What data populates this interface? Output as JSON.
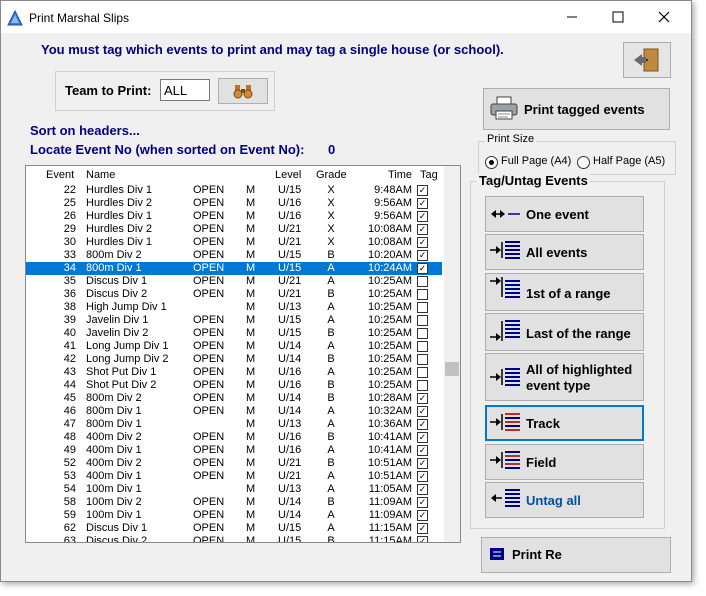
{
  "window": {
    "title": "Print Marshal Slips"
  },
  "instruction": "You must tag which events to print and may tag a single house (or school).",
  "team": {
    "label": "Team to Print:",
    "value": "ALL"
  },
  "sort_text": "Sort on headers...",
  "locate": {
    "label": "Locate Event No (when sorted on Event No):",
    "value": "0"
  },
  "grid": {
    "headers": {
      "event": "Event",
      "name": "Name",
      "level": "Level",
      "grade": "Grade",
      "time": "Time",
      "tag": "Tag"
    },
    "rows": [
      {
        "event": "22",
        "name": "Hurdles Div 1",
        "status": "OPEN",
        "gender": "M",
        "level": "U/15",
        "grade": "X",
        "time": "9:48AM",
        "tag": true
      },
      {
        "event": "25",
        "name": "Hurdles Div 2",
        "status": "OPEN",
        "gender": "M",
        "level": "U/16",
        "grade": "X",
        "time": "9:56AM",
        "tag": true
      },
      {
        "event": "26",
        "name": "Hurdles Div 1",
        "status": "OPEN",
        "gender": "M",
        "level": "U/16",
        "grade": "X",
        "time": "9:56AM",
        "tag": true
      },
      {
        "event": "29",
        "name": "Hurdles Div 2",
        "status": "OPEN",
        "gender": "M",
        "level": "U/21",
        "grade": "X",
        "time": "10:08AM",
        "tag": true
      },
      {
        "event": "30",
        "name": "Hurdles Div 1",
        "status": "OPEN",
        "gender": "M",
        "level": "U/21",
        "grade": "X",
        "time": "10:08AM",
        "tag": true
      },
      {
        "event": "33",
        "name": "800m Div 2",
        "status": "OPEN",
        "gender": "M",
        "level": "U/15",
        "grade": "B",
        "time": "10:20AM",
        "tag": true
      },
      {
        "event": "34",
        "name": "800m Div 1",
        "status": "OPEN",
        "gender": "M",
        "level": "U/15",
        "grade": "A",
        "time": "10:24AM",
        "tag": true,
        "selected": true
      },
      {
        "event": "35",
        "name": "Discus Div 1",
        "status": "OPEN",
        "gender": "M",
        "level": "U/21",
        "grade": "A",
        "time": "10:25AM",
        "tag": false
      },
      {
        "event": "36",
        "name": "Discus Div 2",
        "status": "OPEN",
        "gender": "M",
        "level": "U/21",
        "grade": "B",
        "time": "10:25AM",
        "tag": false
      },
      {
        "event": "38",
        "name": "High Jump Div 1",
        "status": "",
        "gender": "M",
        "level": "U/13",
        "grade": "A",
        "time": "10:25AM",
        "tag": false
      },
      {
        "event": "39",
        "name": "Javelin Div 1",
        "status": "OPEN",
        "gender": "M",
        "level": "U/15",
        "grade": "A",
        "time": "10:25AM",
        "tag": false
      },
      {
        "event": "40",
        "name": "Javelin Div 2",
        "status": "OPEN",
        "gender": "M",
        "level": "U/15",
        "grade": "B",
        "time": "10:25AM",
        "tag": false
      },
      {
        "event": "41",
        "name": "Long Jump Div 1",
        "status": "OPEN",
        "gender": "M",
        "level": "U/14",
        "grade": "A",
        "time": "10:25AM",
        "tag": false
      },
      {
        "event": "42",
        "name": "Long Jump Div 2",
        "status": "OPEN",
        "gender": "M",
        "level": "U/14",
        "grade": "B",
        "time": "10:25AM",
        "tag": false
      },
      {
        "event": "43",
        "name": "Shot Put Div 1",
        "status": "OPEN",
        "gender": "M",
        "level": "U/16",
        "grade": "A",
        "time": "10:25AM",
        "tag": false
      },
      {
        "event": "44",
        "name": "Shot Put Div 2",
        "status": "OPEN",
        "gender": "M",
        "level": "U/16",
        "grade": "B",
        "time": "10:25AM",
        "tag": false
      },
      {
        "event": "45",
        "name": "800m Div 2",
        "status": "OPEN",
        "gender": "M",
        "level": "U/14",
        "grade": "B",
        "time": "10:28AM",
        "tag": true
      },
      {
        "event": "46",
        "name": "800m Div 1",
        "status": "OPEN",
        "gender": "M",
        "level": "U/14",
        "grade": "A",
        "time": "10:32AM",
        "tag": true
      },
      {
        "event": "47",
        "name": "800m Div 1",
        "status": "",
        "gender": "M",
        "level": "U/13",
        "grade": "A",
        "time": "10:36AM",
        "tag": true
      },
      {
        "event": "48",
        "name": "400m Div 2",
        "status": "OPEN",
        "gender": "M",
        "level": "U/16",
        "grade": "B",
        "time": "10:41AM",
        "tag": true
      },
      {
        "event": "49",
        "name": "400m Div 1",
        "status": "OPEN",
        "gender": "M",
        "level": "U/16",
        "grade": "A",
        "time": "10:41AM",
        "tag": true
      },
      {
        "event": "52",
        "name": "400m Div 2",
        "status": "OPEN",
        "gender": "M",
        "level": "U/21",
        "grade": "B",
        "time": "10:51AM",
        "tag": true
      },
      {
        "event": "53",
        "name": "400m Div 1",
        "status": "OPEN",
        "gender": "M",
        "level": "U/21",
        "grade": "A",
        "time": "10:51AM",
        "tag": true
      },
      {
        "event": "54",
        "name": "100m Div 1",
        "status": "",
        "gender": "M",
        "level": "U/13",
        "grade": "A",
        "time": "11:05AM",
        "tag": true
      },
      {
        "event": "58",
        "name": "100m Div 2",
        "status": "OPEN",
        "gender": "M",
        "level": "U/14",
        "grade": "B",
        "time": "11:09AM",
        "tag": true
      },
      {
        "event": "59",
        "name": "100m Div 1",
        "status": "OPEN",
        "gender": "M",
        "level": "U/14",
        "grade": "A",
        "time": "11:09AM",
        "tag": true
      },
      {
        "event": "62",
        "name": "Discus Div 1",
        "status": "OPEN",
        "gender": "M",
        "level": "U/15",
        "grade": "A",
        "time": "11:15AM",
        "tag": true
      },
      {
        "event": "63",
        "name": "Discus Div 2",
        "status": "OPEN",
        "gender": "M",
        "level": "U/15",
        "grade": "B",
        "time": "11:15AM",
        "tag": true
      }
    ]
  },
  "print_button": {
    "label": "Print tagged events"
  },
  "print_size": {
    "legend": "Print Size",
    "options": [
      "Full Page (A4)",
      "Half Page (A5)"
    ],
    "selected": "Full Page (A4)"
  },
  "tag_events": {
    "legend": "Tag/Untag Events",
    "buttons": [
      "One event",
      "All events",
      "1st of a range",
      "Last of the range",
      "All of highlighted event type",
      "Track",
      "Field",
      "Untag all"
    ]
  },
  "bottom_button": {
    "label": "Print Re"
  },
  "colors": {
    "accent": "#0078d7",
    "navy_text": "#000080",
    "selection": "#0078d7"
  }
}
